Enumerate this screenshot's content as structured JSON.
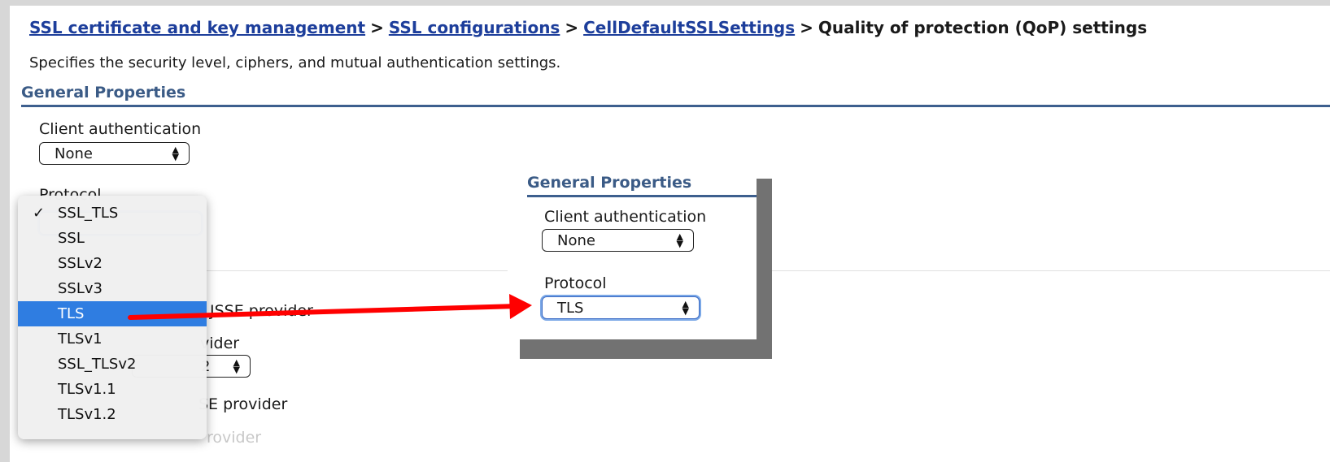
{
  "breadcrumb": {
    "links": [
      "SSL certificate and key management",
      "SSL configurations",
      "CellDefaultSSLSettings"
    ],
    "separator": ">",
    "current": "Quality of protection (QoP) settings"
  },
  "description": "Specifies the security level, ciphers, and mutual authentication settings.",
  "general_properties": {
    "heading": "General Properties",
    "client_auth_label": "Client authentication",
    "client_auth_value": "None",
    "protocol_label": "Protocol",
    "provider_fragment_1": "JSSE provider",
    "provider_fragment_2": "vider",
    "provider_select_fragment": "2",
    "provider_fragment_3": "SE provider",
    "provider_fragment_4": "rovider"
  },
  "protocol_menu": {
    "selected": "SSL_TLS",
    "highlighted": "TLS",
    "items": [
      "SSL_TLS",
      "SSL",
      "SSLv2",
      "SSLv3",
      "TLS",
      "TLSv1",
      "SSL_TLSv2",
      "TLSv1.1",
      "TLSv1.2"
    ]
  },
  "inset": {
    "heading": "General Properties",
    "client_auth_label": "Client authentication",
    "client_auth_value": "None",
    "protocol_label": "Protocol",
    "protocol_value": "TLS"
  },
  "annotation": {
    "arrow_color": "#ff0000"
  },
  "colors": {
    "link": "#1d3e9b",
    "section_heading": "#3b5b86",
    "highlight": "#2f7de1",
    "frame_shadow": "#727272"
  },
  "icons": {
    "check": "check-icon",
    "stepper": "updown-icon",
    "arrow": "red-arrow-icon"
  }
}
